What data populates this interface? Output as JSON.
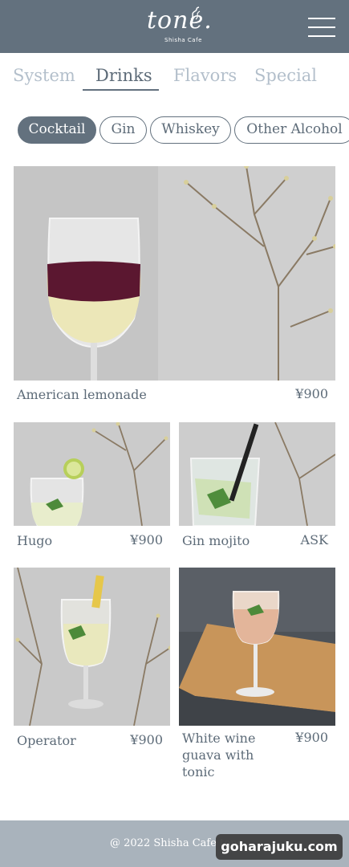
{
  "header": {
    "logo_text": "tone.",
    "logo_subtext": "Shisha Cafe",
    "menu_icon": "hamburger-menu-icon"
  },
  "tabs": [
    {
      "label": "System",
      "active": false
    },
    {
      "label": "Drinks",
      "active": true
    },
    {
      "label": "Flavors",
      "active": false
    },
    {
      "label": "Special",
      "active": false
    }
  ],
  "categories": [
    {
      "label": "Cocktail",
      "active": true
    },
    {
      "label": "Gin",
      "active": false
    },
    {
      "label": "Whiskey",
      "active": false
    },
    {
      "label": "Other Alcohol",
      "active": false
    }
  ],
  "drinks": [
    {
      "name": "American lemonade",
      "price": "¥900"
    },
    {
      "name": "Hugo",
      "price": "¥900"
    },
    {
      "name": "Gin mojito",
      "price": "ASK"
    },
    {
      "name": "Operator",
      "price": "¥900"
    },
    {
      "name": "White wine guava with tonic",
      "price": "¥900"
    }
  ],
  "footer": {
    "copyright": "@ 2022 Shisha Cafe tone."
  },
  "watermark": "goharajuku.com",
  "colors": {
    "header_bg": "#63717e",
    "active_text": "#5d6b78",
    "inactive_tab": "#b3bfcb",
    "footer_bg": "#a9b3bc"
  }
}
